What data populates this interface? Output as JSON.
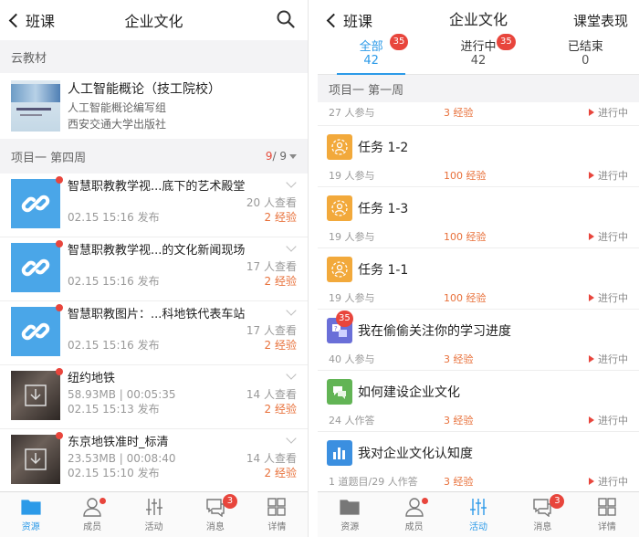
{
  "left": {
    "nav": {
      "back_label": "班课",
      "title": "企业文化"
    },
    "section_label": "云教材",
    "book": {
      "title": "人工智能概论（技工院校）",
      "author": "人工智能概论编写组",
      "publisher": "西安交通大学出版社"
    },
    "week": {
      "label": "项目一 第四周",
      "current": "9",
      "total": "/ 9"
    },
    "resources": [
      {
        "title": "智慧职教教学视...底下的艺术殿堂",
        "views": "20 人查看",
        "date": "02.15 15:16 发布",
        "exp": "2 经验",
        "type": "link"
      },
      {
        "title": "智慧职教教学视...的文化新闻现场",
        "views": "17 人查看",
        "date": "02.15 15:16 发布",
        "exp": "2 经验",
        "type": "link"
      },
      {
        "title": "智慧职教图片：...科地铁代表车站",
        "views": "17 人查看",
        "date": "02.15 15:16 发布",
        "exp": "2 经验",
        "type": "link"
      },
      {
        "title": "纽约地铁",
        "size": "58.93MB | 00:05:35",
        "views": "14 人查看",
        "date": "02.15 15:13 发布",
        "exp": "2 经验",
        "type": "video"
      },
      {
        "title": "东京地铁准时_标清",
        "size": "23.53MB | 00:08:40",
        "views": "14 人查看",
        "date": "02.15 15:10 发布",
        "exp": "2 经验",
        "type": "video"
      }
    ],
    "tabbar": [
      {
        "label": "资源",
        "active": true
      },
      {
        "label": "成员",
        "dot": true
      },
      {
        "label": "活动"
      },
      {
        "label": "消息",
        "badge": "3"
      },
      {
        "label": "详情"
      }
    ]
  },
  "right": {
    "nav": {
      "back_label": "班课",
      "title": "企业文化",
      "action": "课堂表现"
    },
    "filter_tabs": [
      {
        "label": "全部",
        "count": "42",
        "badge": "35",
        "active": true
      },
      {
        "label": "进行中",
        "count": "42",
        "badge": "35"
      },
      {
        "label": "已结束",
        "count": "0"
      }
    ],
    "week_label": "项目一 第一周",
    "partial_item": {
      "participants": "27 人参与",
      "exp": "3 经验",
      "status": "进行中"
    },
    "activities": [
      {
        "title": "任务 1-2",
        "participants": "19 人参与",
        "exp": "100 经验",
        "status": "进行中",
        "icon": "task-icon"
      },
      {
        "title": "任务 1-3",
        "participants": "19 人参与",
        "exp": "100 经验",
        "status": "进行中",
        "icon": "task-icon"
      },
      {
        "title": "任务 1-1",
        "participants": "19 人参与",
        "exp": "100 经验",
        "status": "进行中",
        "icon": "task-icon"
      },
      {
        "title": "我在偷偷关注你的学习进度",
        "participants": "40 人参与",
        "exp": "3 经验",
        "status": "进行中",
        "icon": "quiz-icon",
        "badge": "35"
      },
      {
        "title": "如何建设企业文化",
        "participants": "24 人作答",
        "exp": "3 经验",
        "status": "进行中",
        "icon": "discussion-icon"
      },
      {
        "title": "我对企业文化认知度",
        "participants": "1 道题目/29 人作答",
        "exp": "3 经验",
        "status": "进行中",
        "icon": "survey-icon"
      }
    ],
    "tabbar": [
      {
        "label": "资源"
      },
      {
        "label": "成员",
        "dot": true
      },
      {
        "label": "活动",
        "active": true
      },
      {
        "label": "消息",
        "badge": "3"
      },
      {
        "label": "详情"
      }
    ]
  },
  "colors": {
    "accent": "#2c9ae8",
    "badge": "#e8453c",
    "exp": "#e8703a"
  }
}
